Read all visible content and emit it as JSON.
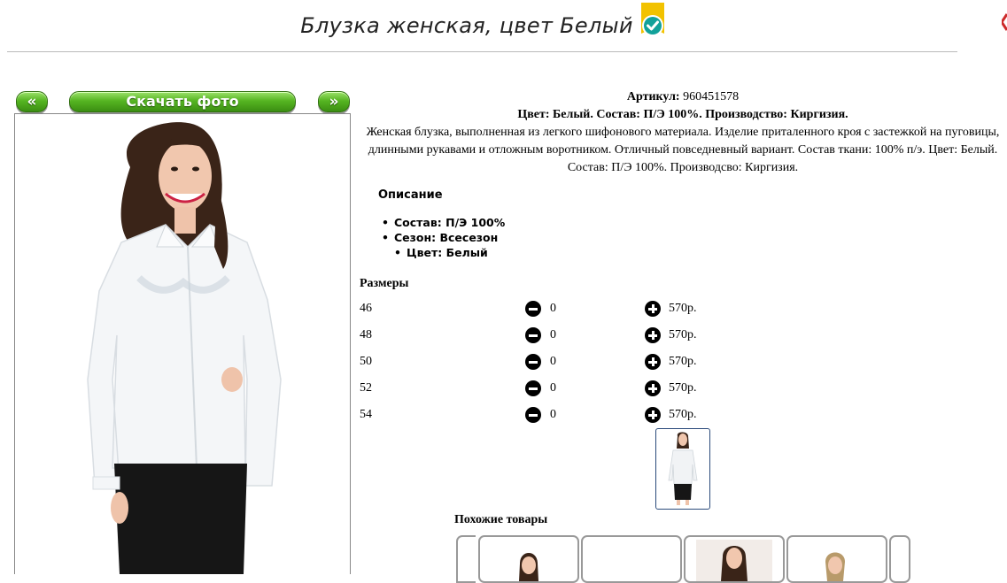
{
  "product": {
    "title": "Блузка женская, цвет Белый",
    "badge_icon": "verified-check-icon",
    "article_label": "Артикул:",
    "article_value": "960451578",
    "summary": "Цвет: Белый. Состав: П/Э 100%. Производство: Киргизия.",
    "description": "Женская блузка, выполненная из легкого шифонового материала. Изделие приталенного кроя с застежкой на пуговицы, длинными рукавами и отложным воротником. Отличный повседневный вариант. Состав ткани: 100% п/э. Цвет: Белый. Состав: П/Э 100%. Производсво: Киргизия."
  },
  "gallery": {
    "prev_label": "«",
    "download_label": "Скачать фото",
    "next_label": "»"
  },
  "attributes": {
    "heading": "Описание",
    "items": [
      "Состав: П/Э 100%",
      "Сезон: Всесезон",
      "Цвет: Белый"
    ]
  },
  "sizes": {
    "heading": "Размеры",
    "rows": [
      {
        "size": "46",
        "qty": "0",
        "price": "570р."
      },
      {
        "size": "48",
        "qty": "0",
        "price": "570р."
      },
      {
        "size": "50",
        "qty": "0",
        "price": "570р."
      },
      {
        "size": "52",
        "qty": "0",
        "price": "570р."
      },
      {
        "size": "54",
        "qty": "0",
        "price": "570р."
      }
    ]
  },
  "similar": {
    "heading": "Похожие товары"
  },
  "colors": {
    "button_green": "#56b522",
    "badge_yellow": "#f2c200",
    "badge_teal": "#12a19a"
  }
}
